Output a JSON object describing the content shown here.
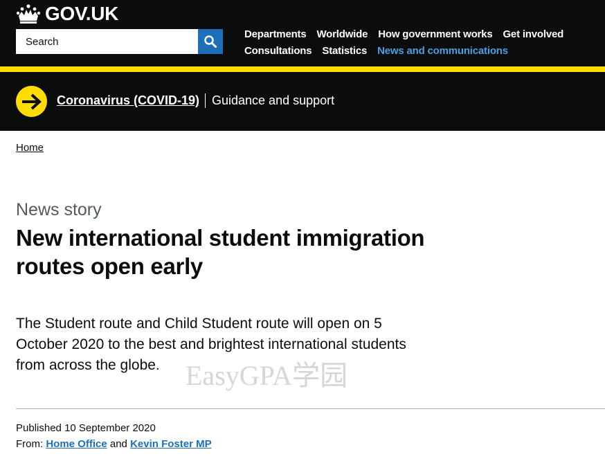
{
  "header": {
    "logo_text": "GOV.UK",
    "search": {
      "placeholder": "Search"
    },
    "nav": [
      {
        "label": "Departments",
        "active": false
      },
      {
        "label": "Worldwide",
        "active": false
      },
      {
        "label": "How government works",
        "active": false
      },
      {
        "label": "Get involved",
        "active": false
      },
      {
        "label": "Consultations",
        "active": false
      },
      {
        "label": "Statistics",
        "active": false
      },
      {
        "label": "News and communications",
        "active": true
      }
    ]
  },
  "covid_banner": {
    "link": "Coronavirus (COVID-19)",
    "subtitle": "Guidance and support"
  },
  "breadcrumb": {
    "home": "Home"
  },
  "article": {
    "caption": "News story",
    "title": "New international student immigration routes open early",
    "lead": "The Student route and Child Student route will open on 5 October 2020 to the best and brightest international students from across the globe."
  },
  "watermark": "EasyGPA学园",
  "meta": {
    "published_label": "Published",
    "published_date": "10 September 2020",
    "from_label": "From:",
    "from_1": "Home Office",
    "and": "and",
    "from_2": "Kevin Foster MP"
  },
  "colors": {
    "header_bg": "#0b0c0c",
    "accent_yellow": "#ffdd00",
    "link_blue": "#1d70b8",
    "active_nav": "#4a9fe5"
  }
}
